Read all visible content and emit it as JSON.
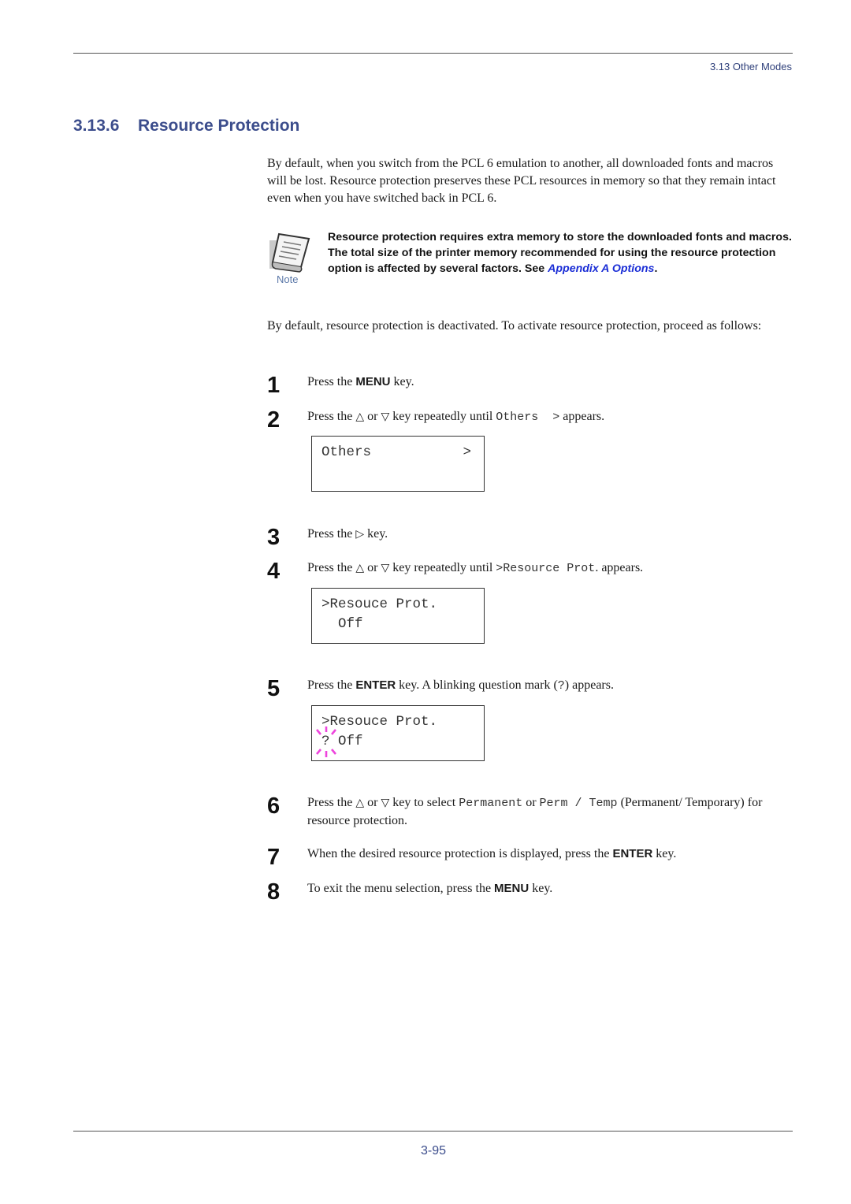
{
  "header": {
    "running_head": "3.13 Other Modes"
  },
  "section": {
    "number": "3.13.6",
    "title": "Resource Protection"
  },
  "intro_paragraph": "By default, when you switch from the PCL 6 emulation to another, all downloaded fonts and macros will be lost. Resource protection preserves these PCL resources in memory so that they remain intact even when you have switched back in PCL 6.",
  "note": {
    "label": "Note",
    "icon": "note-paper-icon",
    "text": "Resource protection requires extra memory to store the downloaded fonts and macros. The total size of the printer memory recommended for using the resource protection option is affected by several factors. See ",
    "link_text": "Appendix A Options",
    "text_end": "."
  },
  "activate_paragraph": "By default, resource protection is deactivated. To activate resource protection, proceed as follows:",
  "symbols": {
    "up": "△",
    "down": "▽",
    "right": "▷"
  },
  "steps": [
    {
      "number": "1",
      "pre": "Press the ",
      "key": "MENU",
      "post": " key."
    },
    {
      "number": "2",
      "pre": "Press the ",
      "mid1": " or ",
      "mid2": " key repeatedly until ",
      "code": "Others  >",
      "post": " appears."
    },
    {
      "number": "3",
      "pre": "Press the ",
      "post": " key."
    },
    {
      "number": "4",
      "pre": "Press the ",
      "mid1": " or ",
      "mid2": " key repeatedly until ",
      "code": ">Resource Prot",
      "post": ". appears."
    },
    {
      "number": "5",
      "pre": "Press the ",
      "key": "ENTER",
      "mid": " key. A blinking question mark (",
      "code": "?",
      "post": ") appears."
    },
    {
      "number": "6",
      "pre": "Press the ",
      "mid1": " or ",
      "mid2": " key to select ",
      "code1": "Permanent",
      "or": " or ",
      "code2": "Perm / Temp",
      "post": " (Permanent/ Temporary) for resource protection."
    },
    {
      "number": "7",
      "pre": "When the desired resource protection is displayed, press the ",
      "key": "ENTER",
      "post": " key."
    },
    {
      "number": "8",
      "pre": "To exit the menu selection, press the ",
      "key": "MENU",
      "post": " key."
    }
  ],
  "lcd_displays": [
    {
      "line1": "Others",
      "arrow": ">",
      "line2": ""
    },
    {
      "line1": ">Resouce Prot.",
      "line2": "  Off"
    },
    {
      "line1": ">Resouce Prot.",
      "line2": "? Off",
      "blinking": "?"
    }
  ],
  "footer": {
    "page_number": "3-95"
  }
}
